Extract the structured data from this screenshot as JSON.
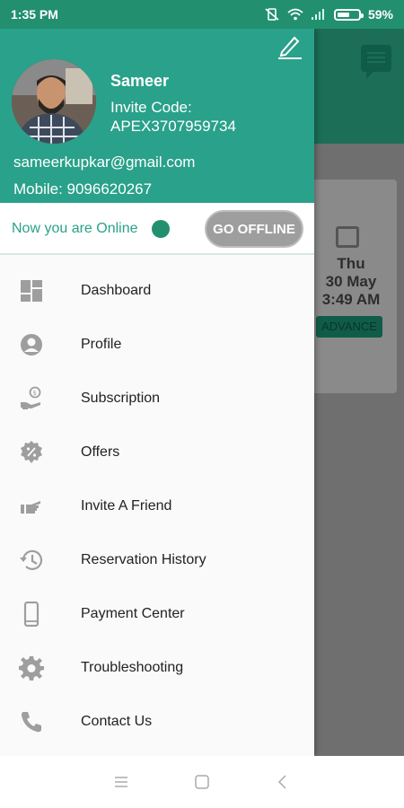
{
  "status": {
    "time": "1:35 PM",
    "battery": "59%",
    "battery_level": 0.59
  },
  "background": {
    "card_day": "Thu",
    "card_date": "30 May",
    "card_time": "3:49 AM",
    "card_button": "ADVANCE"
  },
  "drawer": {
    "name": "Sameer",
    "invite_label": "Invite Code:",
    "invite_code": "APEX3707959734",
    "email": "sameerkupkar@gmail.com",
    "mobile": "Mobile: 9096620267",
    "online_text": "Now you are Online",
    "offline_button": "GO OFFLINE",
    "menu": [
      {
        "label": "Dashboard",
        "icon": "dashboard-icon"
      },
      {
        "label": "Profile",
        "icon": "profile-icon"
      },
      {
        "label": "Subscription",
        "icon": "subscription-icon"
      },
      {
        "label": "Offers",
        "icon": "offers-icon"
      },
      {
        "label": "Invite A Friend",
        "icon": "invite-icon"
      },
      {
        "label": "Reservation History",
        "icon": "history-icon"
      },
      {
        "label": "Payment Center",
        "icon": "phone-icon"
      },
      {
        "label": "Troubleshooting",
        "icon": "gear-icon"
      },
      {
        "label": "Contact Us",
        "icon": "call-icon"
      }
    ]
  },
  "colors": {
    "primary": "#2aa18a",
    "status_bar": "#22906f",
    "online_dot": "#22906f",
    "offline_button": "#9e9e9e"
  }
}
